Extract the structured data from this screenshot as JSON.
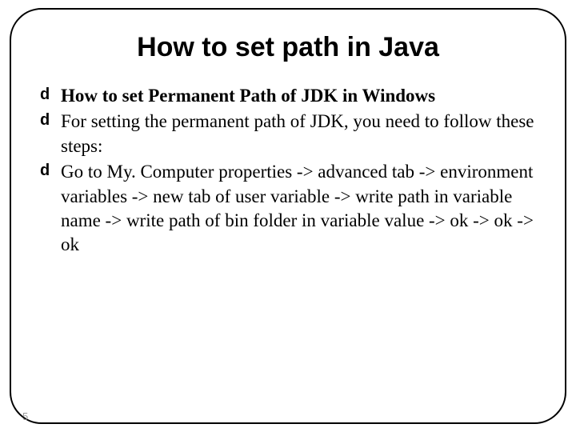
{
  "title": "How to set path in Java",
  "bullets": [
    {
      "bold": true,
      "text": "How to set Permanent Path of JDK in Windows"
    },
    {
      "bold": false,
      "text": "For setting the permanent path of JDK, you need to follow these steps:"
    },
    {
      "bold": false,
      "text": "Go to My. Computer properties -> advanced tab -> environment variables -> new tab of user variable -> write path in variable name -> write path of bin folder in variable value -> ok -> ok -> ok"
    }
  ],
  "bullet_glyph": "d",
  "page_number": "5"
}
